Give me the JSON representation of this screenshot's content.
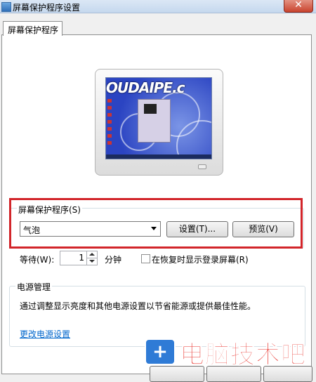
{
  "window": {
    "title": "屏幕保护程序设置",
    "close_glyph": "✕"
  },
  "tabs": [
    {
      "label": "屏幕保护程序"
    }
  ],
  "preview": {
    "watermark_text": "OUDAIPE.c"
  },
  "screensaver": {
    "group_label": "屏幕保护程序(S)",
    "selected": "气泡",
    "settings_button": "设置(T)...",
    "preview_button": "预览(V)"
  },
  "wait": {
    "label": "等待(W):",
    "value": "1",
    "unit": "分钟",
    "resume_checkbox_label": "在恢复时显示登录屏幕(R)",
    "resume_checked": false
  },
  "power": {
    "group_label": "电源管理",
    "description": "通过调整显示亮度和其他电源设置以节省能源或提供最佳性能。",
    "link": "更改电源设置"
  },
  "watermark": {
    "text": "电脑技术吧",
    "icon": "plus-icon"
  },
  "colors": {
    "highlight": "#d2252a",
    "link": "#0066cc",
    "watermark": "#e8322b"
  }
}
